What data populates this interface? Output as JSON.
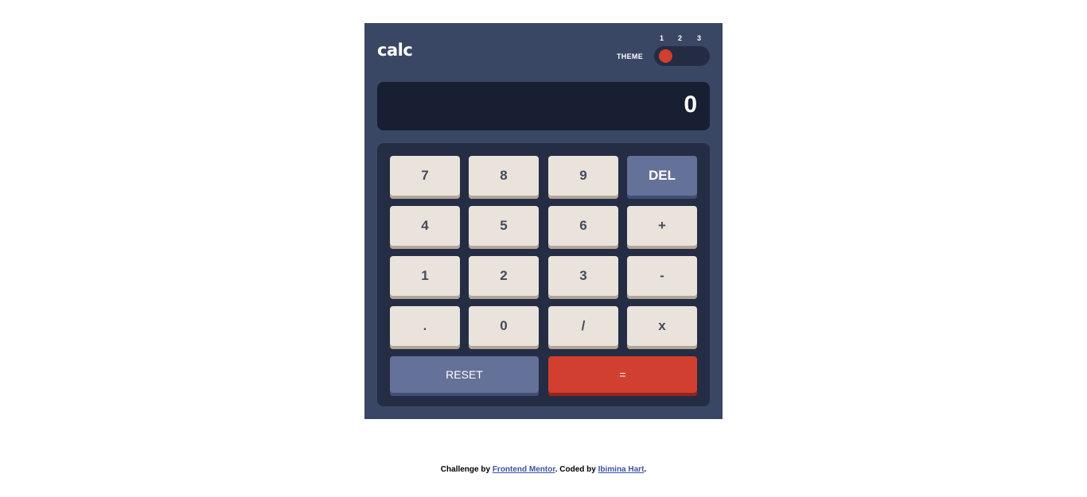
{
  "header": {
    "logo": "calc",
    "theme_label": "THEME",
    "theme_options": [
      "1",
      "2",
      "3"
    ],
    "active_theme": 1
  },
  "screen": {
    "value": "0"
  },
  "keypad": {
    "keys": [
      "7",
      "8",
      "9",
      "DEL",
      "4",
      "5",
      "6",
      "+",
      "1",
      "2",
      "3",
      "-",
      ".",
      "0",
      "/",
      "x"
    ],
    "reset_label": "RESET",
    "equals_label": "="
  },
  "footer": {
    "prefix": "Challenge by ",
    "link1": "Frontend Mentor",
    "middle": ". Coded by ",
    "link2": "Ibimina Hart",
    "suffix": "."
  },
  "colors": {
    "main_bg": "#3a4764",
    "keypad_bg": "#242d44",
    "screen_bg": "#181f32",
    "key_bg": "#eae3dc",
    "key_shadow": "#b4a597",
    "accent_blue": "#647198",
    "accent_red": "#d03f2f",
    "text_dark": "#444b5a"
  }
}
